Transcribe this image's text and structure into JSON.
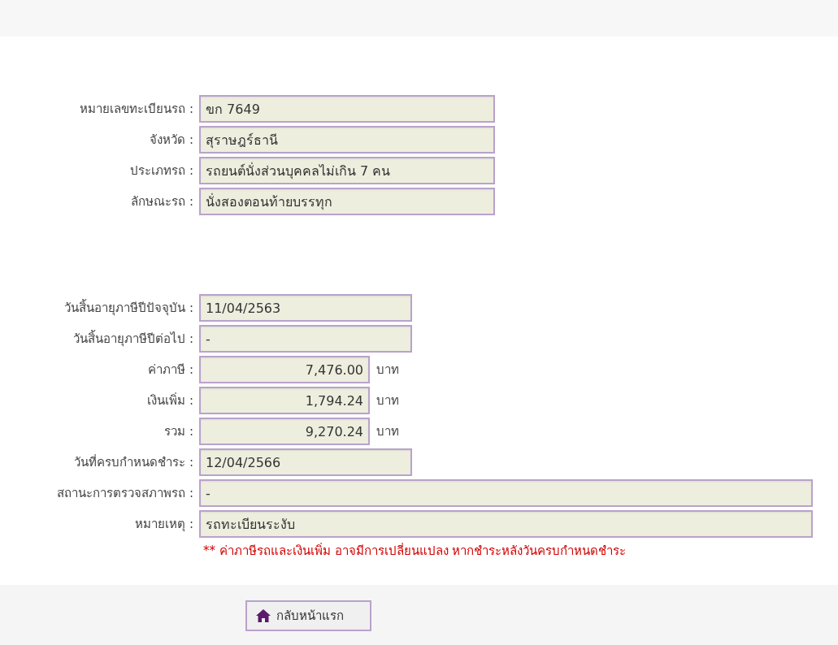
{
  "vehicle": [
    {
      "label": "หมายเลขทะเบียนรถ :",
      "value": "ขก 7649",
      "kind": "long"
    },
    {
      "label": "จังหวัด :",
      "value": "สุราษฎร์ธานี",
      "kind": "long"
    },
    {
      "label": "ประเภทรถ :",
      "value": "รถยนต์นั่งส่วนบุคคลไม่เกิน 7 คน",
      "kind": "long"
    },
    {
      "label": "ลักษณะรถ :",
      "value": "นั่งสองตอนท้ายบรรทุก",
      "kind": "long"
    }
  ],
  "tax": [
    {
      "label": "วันสิ้นอายุภาษีปีปัจจุบัน :",
      "value": "11/04/2563",
      "kind": "date"
    },
    {
      "label": "วันสิ้นอายุภาษีปีต่อไป :",
      "value": "-",
      "kind": "date"
    },
    {
      "label": "ค่าภาษี :",
      "value": "7,476.00",
      "kind": "money",
      "unit": "บาท"
    },
    {
      "label": "เงินเพิ่ม :",
      "value": "1,794.24",
      "kind": "money",
      "unit": "บาท"
    },
    {
      "label": "รวม :",
      "value": "9,270.24",
      "kind": "money",
      "unit": "บาท"
    },
    {
      "label": "วันที่ครบกำหนดชำระ :",
      "value": "12/04/2566",
      "kind": "date"
    },
    {
      "label": "สถานะการตรวจสภาพรถ :",
      "value": "-",
      "kind": "wide"
    },
    {
      "label": "หมายเหตุ :",
      "value": "รถทะเบียนระงับ",
      "kind": "wide"
    }
  ],
  "note": "** ค่าภาษีรถและเงินเพิ่ม อาจมีการเปลี่ยนแปลง หากชำระหลังวันครบกำหนดชำระ",
  "home_button": "กลับหน้าแรก"
}
